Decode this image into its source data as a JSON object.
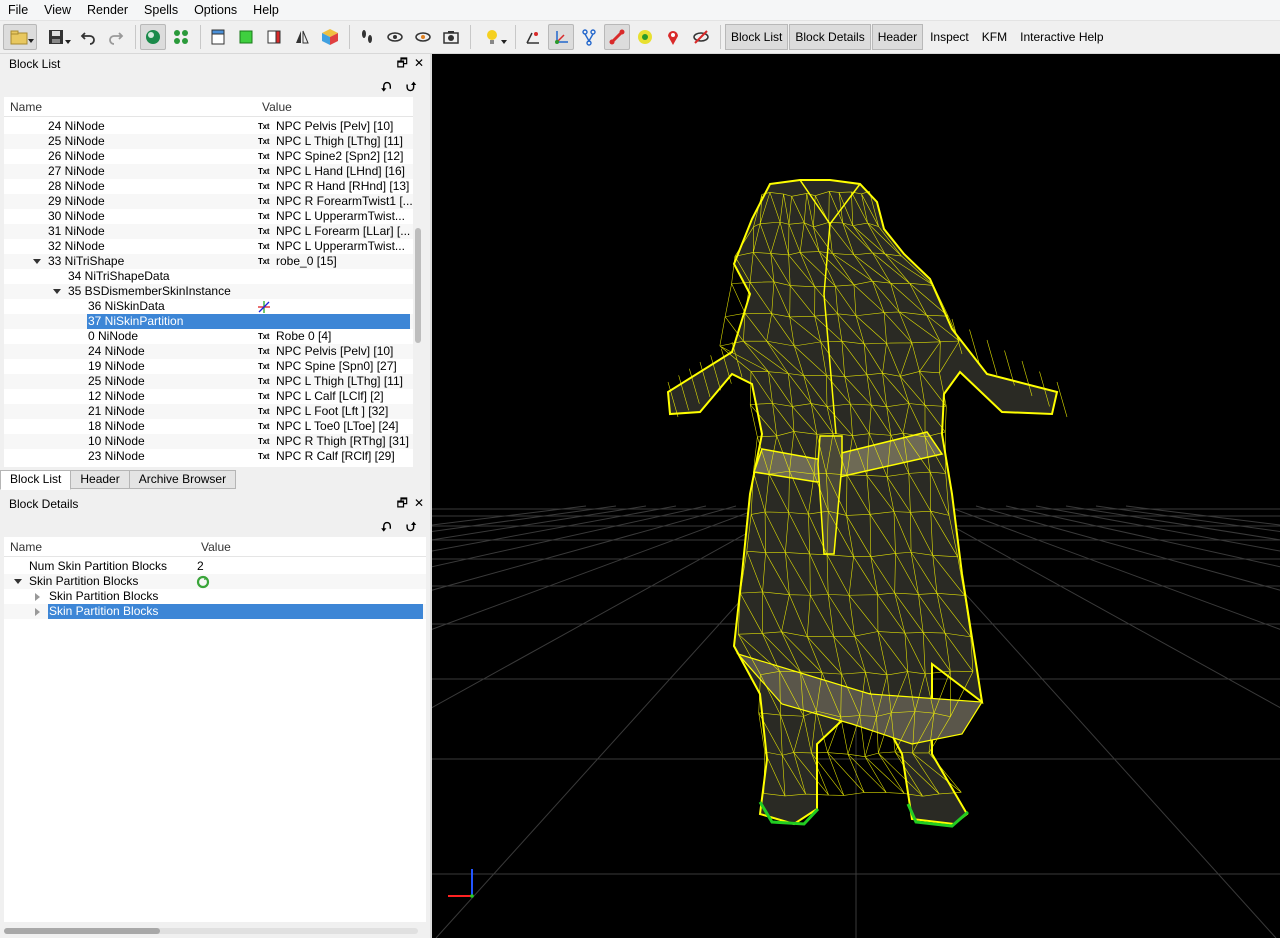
{
  "menu": [
    "File",
    "View",
    "Render",
    "Spells",
    "Options",
    "Help"
  ],
  "toolbar_text_buttons": [
    "Block List",
    "Block Details",
    "Header",
    "Inspect",
    "KFM",
    "Interactive Help"
  ],
  "block_list": {
    "title": "Block List",
    "columns": {
      "name": "Name",
      "value": "Value"
    },
    "txt_tag": "Txt",
    "rows": [
      {
        "name": "24 NiNode",
        "value": "NPC Pelvis [Pelv] [10]",
        "indent": 1,
        "txt": true
      },
      {
        "name": "25 NiNode",
        "value": "NPC L Thigh [LThg] [11]",
        "indent": 1,
        "txt": true
      },
      {
        "name": "26 NiNode",
        "value": "NPC Spine2 [Spn2] [12]",
        "indent": 1,
        "txt": true
      },
      {
        "name": "27 NiNode",
        "value": "NPC L Hand [LHnd] [16]",
        "indent": 1,
        "txt": true
      },
      {
        "name": "28 NiNode",
        "value": "NPC R Hand [RHnd] [13]",
        "indent": 1,
        "txt": true
      },
      {
        "name": "29 NiNode",
        "value": "NPC R ForearmTwist1 [...",
        "indent": 1,
        "txt": true
      },
      {
        "name": "30 NiNode",
        "value": "NPC L UpperarmTwist...",
        "indent": 1,
        "txt": true
      },
      {
        "name": "31 NiNode",
        "value": "NPC L Forearm [LLar] [...",
        "indent": 1,
        "txt": true
      },
      {
        "name": "32 NiNode",
        "value": "NPC L UpperarmTwist...",
        "indent": 1,
        "txt": true
      },
      {
        "name": "33 NiTriShape",
        "value": "robe_0 [15]",
        "indent": 1,
        "txt": true,
        "expanded": true
      },
      {
        "name": "34 NiTriShapeData",
        "value": "",
        "indent": 2,
        "txt": false
      },
      {
        "name": "35 BSDismemberSkinInstance",
        "value": "",
        "indent": 2,
        "txt": false,
        "expanded": true
      },
      {
        "name": "36 NiSkinData",
        "value": "",
        "indent": 3,
        "txt": false,
        "icon": "axes-icon"
      },
      {
        "name": "37 NiSkinPartition",
        "value": "",
        "indent": 3,
        "txt": false,
        "selected": true
      },
      {
        "name": "0 NiNode",
        "value": "Robe 0 [4]",
        "indent": 3,
        "txt": true
      },
      {
        "name": "24 NiNode",
        "value": "NPC Pelvis [Pelv] [10]",
        "indent": 3,
        "txt": true
      },
      {
        "name": "19 NiNode",
        "value": "NPC Spine [Spn0] [27]",
        "indent": 3,
        "txt": true
      },
      {
        "name": "25 NiNode",
        "value": "NPC L Thigh [LThg] [11]",
        "indent": 3,
        "txt": true
      },
      {
        "name": "12 NiNode",
        "value": "NPC L Calf [LClf] [2]",
        "indent": 3,
        "txt": true
      },
      {
        "name": "21 NiNode",
        "value": "NPC L Foot [Lft ] [32]",
        "indent": 3,
        "txt": true
      },
      {
        "name": "18 NiNode",
        "value": "NPC L Toe0 [LToe] [24]",
        "indent": 3,
        "txt": true
      },
      {
        "name": "10 NiNode",
        "value": "NPC R Thigh [RThg] [31]",
        "indent": 3,
        "txt": true
      },
      {
        "name": "23 NiNode",
        "value": "NPC R Calf [RClf] [29]",
        "indent": 3,
        "txt": true
      }
    ]
  },
  "tabs": [
    {
      "label": "Block List",
      "active": true
    },
    {
      "label": "Header",
      "active": false
    },
    {
      "label": "Archive Browser",
      "active": false
    }
  ],
  "block_details": {
    "title": "Block Details",
    "columns": {
      "name": "Name",
      "value": "Value"
    },
    "rows": [
      {
        "name": "Num Skin Partition Blocks",
        "value": "2",
        "indent": 0
      },
      {
        "name": "Skin Partition Blocks",
        "value": "",
        "indent": 0,
        "expanded": true,
        "icon": "refresh-icon"
      },
      {
        "name": "Skin Partition Blocks",
        "value": "",
        "indent": 1,
        "collapsed": true
      },
      {
        "name": "Skin Partition Blocks",
        "value": "",
        "indent": 1,
        "collapsed": true,
        "selected": true
      }
    ]
  },
  "colors": {
    "selection": "#3d86d6",
    "wireframe": "#ffff00",
    "viewport_bg": "#000000",
    "grid": "#3a3a3a",
    "feet_highlight": "#22cc22"
  }
}
